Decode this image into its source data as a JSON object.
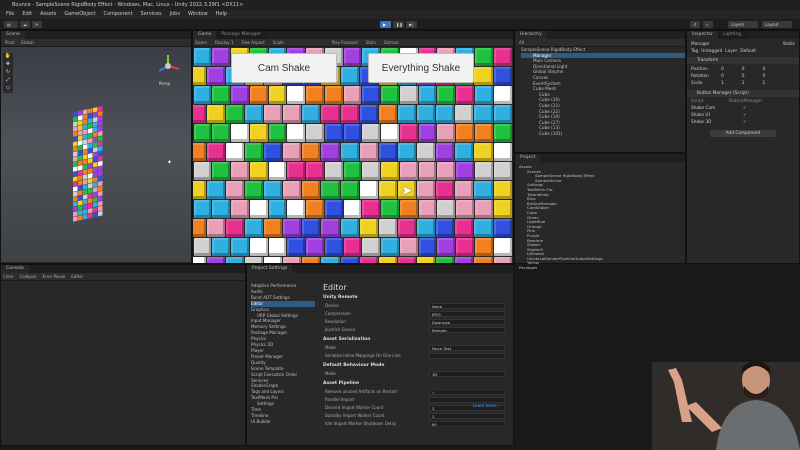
{
  "window": {
    "title": "Bounce - SampleScene RigidBody Effect - Windows, Mac, Linux - Unity 2022.3.29f1 <DX11>"
  },
  "menu": [
    "File",
    "Edit",
    "Assets",
    "GameObject",
    "Component",
    "Services",
    "Jobs",
    "Window",
    "Help"
  ],
  "toolbar": {
    "layers": "Layers",
    "layout": "Layout"
  },
  "scene": {
    "tab": "Scene",
    "mode": "Pivot",
    "space": "Global",
    "persp": "Persp"
  },
  "game": {
    "tab_game": "Game",
    "tab_pm": "Package Manager",
    "display": "Game",
    "display2": "Display 1",
    "aspect": "Free Aspect",
    "scale": "Scale",
    "play_focused": "Play Focused",
    "stats": "Stats",
    "gizmos": "Gizmos",
    "button1": "Cam Shake",
    "button2": "Everything Shake"
  },
  "hierarchy": {
    "tab": "Hierarchy",
    "search": "All",
    "items": [
      "SampleScene RigidBody Effect",
      "Manager",
      "Main Camera",
      "Directional Light",
      "Global Volume",
      "Canvas",
      "EventSystem",
      "Cube Mesh",
      "Cube",
      "Cube (30)",
      "Cube (21)",
      "Cube (22)",
      "Cube (10)",
      "Cube (27)",
      "Cube (13)",
      "Cube (101)"
    ]
  },
  "inspector": {
    "tab": "Inspector",
    "tab2": "Lighting",
    "name": "Manager",
    "static": "Static",
    "tag_label": "Tag",
    "tag": "Untagged",
    "layer_label": "Layer",
    "layer": "Default",
    "transform": "Transform",
    "pos_label": "Position",
    "rot_label": "Rotation",
    "scale_label": "Scale",
    "pos": [
      "0",
      "0",
      "0"
    ],
    "rot": [
      "0",
      "0",
      "0"
    ],
    "scl": [
      "1",
      "1",
      "1"
    ],
    "script": "Button Manager (Script)",
    "script_field": "Script",
    "script_value": "ButtonManager",
    "fields": [
      "Shake Cam",
      "Shake UI",
      "Shake 3D"
    ],
    "add": "Add Component"
  },
  "project": {
    "tab": "Project",
    "items": [
      "Assets",
      "Scenes",
      "SampleScene RigidBody Effect",
      "SampleScene",
      "Settings",
      "TextMesh Pro",
      "TutorialInfo",
      "Blue",
      "ButtonManager",
      "CamShaker",
      "Cube",
      "Green",
      "LightBlue",
      "Orange",
      "Pink",
      "Purple",
      "Readme",
      "Shaker",
      "Shaker3",
      "UIShaker",
      "UniversalRenderPipelineGlobalSettings",
      "Yellow",
      "Packages"
    ]
  },
  "console": {
    "tab": "Console",
    "clear": "Clear",
    "collapse": "Collapse",
    "error_pause": "Error Pause",
    "editor": "Editor"
  },
  "project_settings": {
    "tab": "Project Settings",
    "nav": [
      "Adaptive Performance",
      "Audio",
      "Burst AOT Settings",
      "Editor",
      "Graphics",
      "URP Global Settings",
      "Input Manager",
      "Memory Settings",
      "Package Manager",
      "Physics",
      "Physics 2D",
      "Player",
      "Preset Manager",
      "Quality",
      "Scene Template",
      "Script Execution Order",
      "Services",
      "ShaderGraph",
      "Tags and Layers",
      "TextMesh Pro",
      "Settings",
      "Time",
      "Timeline",
      "UI Builder"
    ],
    "heading": "Editor",
    "sections": [
      {
        "title": "Unity Remote",
        "rows": [
          [
            "Device",
            "None"
          ],
          [
            "Compression",
            "JPEG"
          ],
          [
            "Resolution",
            "Downsize"
          ],
          [
            "Joystick Source",
            "Remote"
          ]
        ]
      },
      {
        "title": "Asset Serialization",
        "rows": [
          [
            "Mode",
            "Force Text"
          ],
          [
            "Serialize Inline Mappings On One Line",
            ""
          ]
        ]
      },
      {
        "title": "Default Behaviour Mode",
        "rows": [
          [
            "Mode",
            "3D"
          ]
        ]
      },
      {
        "title": "Asset Pipeline",
        "rows": [
          [
            "Remove unused Artifacts on Restart",
            "✓"
          ],
          [
            "Parallel Import",
            ""
          ],
          [
            "Desired Import Worker Count",
            "3"
          ],
          [
            "Standby Import Worker Count",
            "2"
          ],
          [
            "Idle Import Worker Shutdown Delay",
            "60"
          ]
        ]
      }
    ],
    "learn_more": "Learn more..."
  },
  "colors": {
    "accent": "#2c5d87",
    "play_blue": "#3a79c0"
  }
}
